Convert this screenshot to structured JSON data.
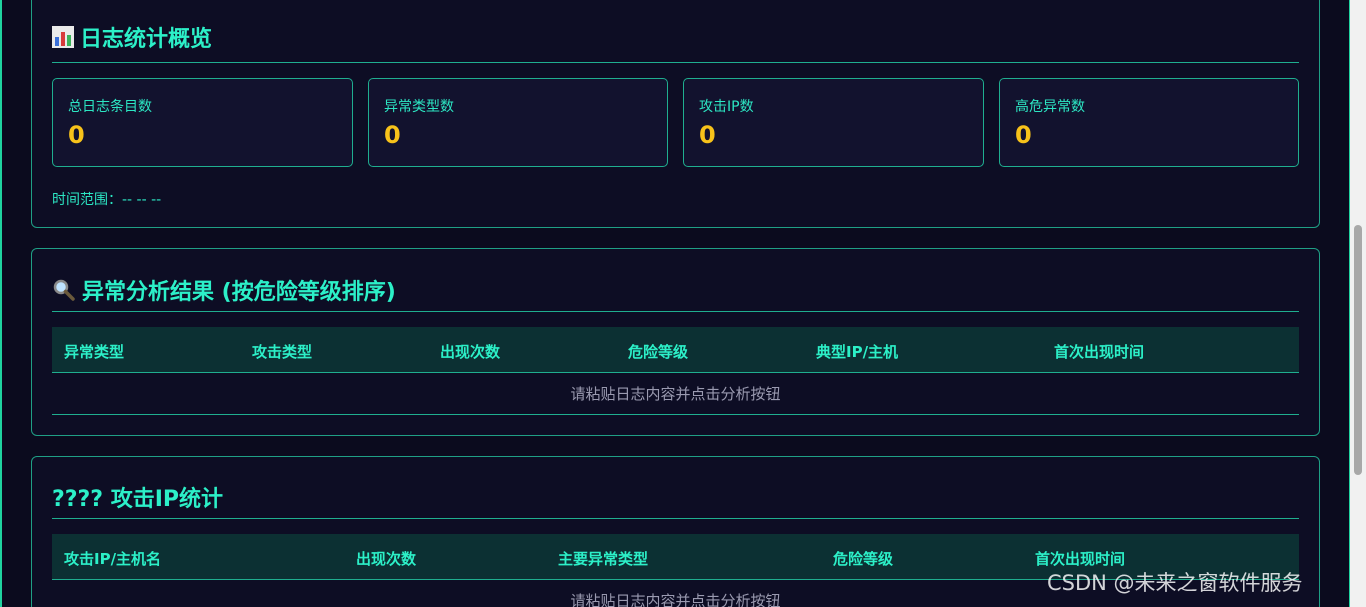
{
  "overview": {
    "title": "日志统计概览",
    "stats": [
      {
        "label": "总日志条目数",
        "value": "0"
      },
      {
        "label": "异常类型数",
        "value": "0"
      },
      {
        "label": "攻击IP数",
        "value": "0"
      },
      {
        "label": "高危异常数",
        "value": "0"
      }
    ],
    "time_range": "时间范围：-- -- --"
  },
  "anomaly": {
    "title": "异常分析结果 (按危险等级排序)",
    "columns": [
      "异常类型",
      "攻击类型",
      "出现次数",
      "危险等级",
      "典型IP/主机",
      "首次出现时间"
    ],
    "empty_text": "请粘贴日志内容并点击分析按钮"
  },
  "ip_stats": {
    "title": "???? 攻击IP统计",
    "columns": [
      "攻击IP/主机名",
      "出现次数",
      "主要异常类型",
      "危险等级",
      "首次出现时间"
    ],
    "empty_text": "请粘贴日志内容并点击分析按钮"
  },
  "watermark": "CSDN @未来之窗软件服务",
  "icons": {
    "overview": "bar-chart-icon",
    "anomaly": "magnifier-icon"
  },
  "colors": {
    "accent": "#2cf0c8",
    "value": "#f7c21a",
    "background": "#0b0b1e"
  }
}
